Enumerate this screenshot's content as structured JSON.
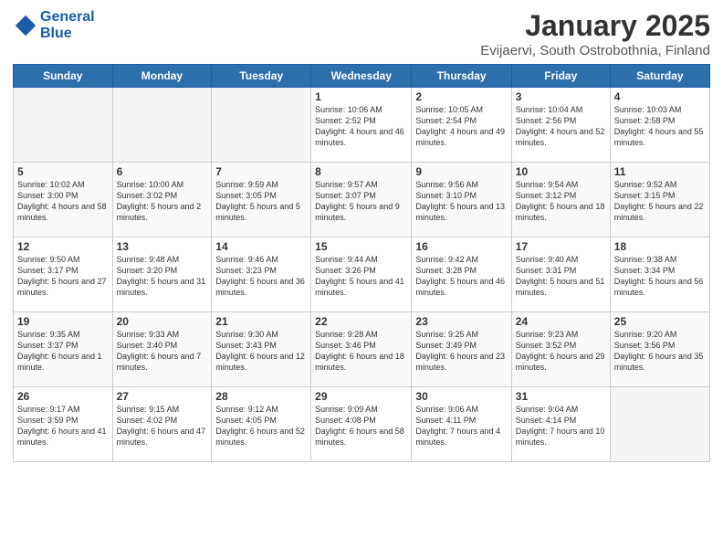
{
  "logo": {
    "line1": "General",
    "line2": "Blue"
  },
  "title": "January 2025",
  "subtitle": "Evijaervi, South Ostrobothnia, Finland",
  "days_of_week": [
    "Sunday",
    "Monday",
    "Tuesday",
    "Wednesday",
    "Thursday",
    "Friday",
    "Saturday"
  ],
  "weeks": [
    [
      {
        "day": "",
        "content": ""
      },
      {
        "day": "",
        "content": ""
      },
      {
        "day": "",
        "content": ""
      },
      {
        "day": "1",
        "content": "Sunrise: 10:06 AM\nSunset: 2:52 PM\nDaylight: 4 hours\nand 46 minutes."
      },
      {
        "day": "2",
        "content": "Sunrise: 10:05 AM\nSunset: 2:54 PM\nDaylight: 4 hours\nand 49 minutes."
      },
      {
        "day": "3",
        "content": "Sunrise: 10:04 AM\nSunset: 2:56 PM\nDaylight: 4 hours\nand 52 minutes."
      },
      {
        "day": "4",
        "content": "Sunrise: 10:03 AM\nSunset: 2:58 PM\nDaylight: 4 hours\nand 55 minutes."
      }
    ],
    [
      {
        "day": "5",
        "content": "Sunrise: 10:02 AM\nSunset: 3:00 PM\nDaylight: 4 hours\nand 58 minutes."
      },
      {
        "day": "6",
        "content": "Sunrise: 10:00 AM\nSunset: 3:02 PM\nDaylight: 5 hours\nand 2 minutes."
      },
      {
        "day": "7",
        "content": "Sunrise: 9:59 AM\nSunset: 3:05 PM\nDaylight: 5 hours\nand 5 minutes."
      },
      {
        "day": "8",
        "content": "Sunrise: 9:57 AM\nSunset: 3:07 PM\nDaylight: 5 hours\nand 9 minutes."
      },
      {
        "day": "9",
        "content": "Sunrise: 9:56 AM\nSunset: 3:10 PM\nDaylight: 5 hours\nand 13 minutes."
      },
      {
        "day": "10",
        "content": "Sunrise: 9:54 AM\nSunset: 3:12 PM\nDaylight: 5 hours\nand 18 minutes."
      },
      {
        "day": "11",
        "content": "Sunrise: 9:52 AM\nSunset: 3:15 PM\nDaylight: 5 hours\nand 22 minutes."
      }
    ],
    [
      {
        "day": "12",
        "content": "Sunrise: 9:50 AM\nSunset: 3:17 PM\nDaylight: 5 hours\nand 27 minutes."
      },
      {
        "day": "13",
        "content": "Sunrise: 9:48 AM\nSunset: 3:20 PM\nDaylight: 5 hours\nand 31 minutes."
      },
      {
        "day": "14",
        "content": "Sunrise: 9:46 AM\nSunset: 3:23 PM\nDaylight: 5 hours\nand 36 minutes."
      },
      {
        "day": "15",
        "content": "Sunrise: 9:44 AM\nSunset: 3:26 PM\nDaylight: 5 hours\nand 41 minutes."
      },
      {
        "day": "16",
        "content": "Sunrise: 9:42 AM\nSunset: 3:28 PM\nDaylight: 5 hours\nand 46 minutes."
      },
      {
        "day": "17",
        "content": "Sunrise: 9:40 AM\nSunset: 3:31 PM\nDaylight: 5 hours\nand 51 minutes."
      },
      {
        "day": "18",
        "content": "Sunrise: 9:38 AM\nSunset: 3:34 PM\nDaylight: 5 hours\nand 56 minutes."
      }
    ],
    [
      {
        "day": "19",
        "content": "Sunrise: 9:35 AM\nSunset: 3:37 PM\nDaylight: 6 hours\nand 1 minute."
      },
      {
        "day": "20",
        "content": "Sunrise: 9:33 AM\nSunset: 3:40 PM\nDaylight: 6 hours\nand 7 minutes."
      },
      {
        "day": "21",
        "content": "Sunrise: 9:30 AM\nSunset: 3:43 PM\nDaylight: 6 hours\nand 12 minutes."
      },
      {
        "day": "22",
        "content": "Sunrise: 9:28 AM\nSunset: 3:46 PM\nDaylight: 6 hours\nand 18 minutes."
      },
      {
        "day": "23",
        "content": "Sunrise: 9:25 AM\nSunset: 3:49 PM\nDaylight: 6 hours\nand 23 minutes."
      },
      {
        "day": "24",
        "content": "Sunrise: 9:23 AM\nSunset: 3:52 PM\nDaylight: 6 hours\nand 29 minutes."
      },
      {
        "day": "25",
        "content": "Sunrise: 9:20 AM\nSunset: 3:56 PM\nDaylight: 6 hours\nand 35 minutes."
      }
    ],
    [
      {
        "day": "26",
        "content": "Sunrise: 9:17 AM\nSunset: 3:59 PM\nDaylight: 6 hours\nand 41 minutes."
      },
      {
        "day": "27",
        "content": "Sunrise: 9:15 AM\nSunset: 4:02 PM\nDaylight: 6 hours\nand 47 minutes."
      },
      {
        "day": "28",
        "content": "Sunrise: 9:12 AM\nSunset: 4:05 PM\nDaylight: 6 hours\nand 52 minutes."
      },
      {
        "day": "29",
        "content": "Sunrise: 9:09 AM\nSunset: 4:08 PM\nDaylight: 6 hours\nand 58 minutes."
      },
      {
        "day": "30",
        "content": "Sunrise: 9:06 AM\nSunset: 4:11 PM\nDaylight: 7 hours\nand 4 minutes."
      },
      {
        "day": "31",
        "content": "Sunrise: 9:04 AM\nSunset: 4:14 PM\nDaylight: 7 hours\nand 10 minutes."
      },
      {
        "day": "",
        "content": ""
      }
    ]
  ]
}
